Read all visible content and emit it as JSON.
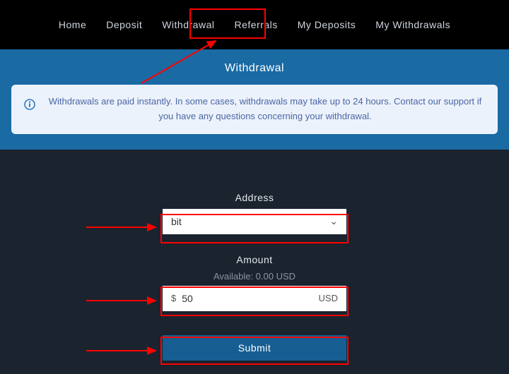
{
  "nav": {
    "items": [
      {
        "label": "Home"
      },
      {
        "label": "Deposit"
      },
      {
        "label": "Withdrawal"
      },
      {
        "label": "Referrals"
      },
      {
        "label": "My Deposits"
      },
      {
        "label": "My Withdrawals"
      }
    ]
  },
  "hero": {
    "title": "Withdrawal",
    "notice": "Withdrawals are paid instantly. In some cases, withdrawals may take up to 24 hours. Contact our support if you have any questions concerning your withdrawal."
  },
  "form": {
    "address_label": "Address",
    "address_value": "bit",
    "amount_label": "Amount",
    "available_label": "Available: 0.00 USD",
    "currency_prefix": "$",
    "amount_value": "50",
    "currency_suffix": "USD",
    "submit_label": "Submit"
  },
  "colors": {
    "nav_bg": "#000000",
    "hero_bg": "#1a6aa4",
    "body_bg": "#1a232e",
    "notice_bg": "#ecf2fb",
    "annotation": "#ff0000"
  }
}
